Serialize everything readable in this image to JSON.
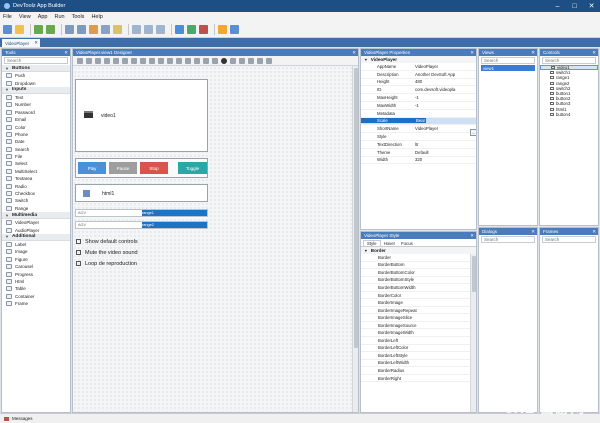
{
  "app": {
    "title": "DevToolz App Builder"
  },
  "menu": [
    "File",
    "View",
    "App",
    "Run",
    "Tools",
    "Help"
  ],
  "doc_tab": {
    "label": "VideoPlayer"
  },
  "tools": {
    "title": "Tools",
    "search_placeholder": "Search",
    "groups": [
      {
        "name": "Buttons",
        "items": [
          "Push",
          "Dropdown"
        ]
      },
      {
        "name": "Inputs",
        "items": [
          "Text",
          "Number",
          "Password",
          "Email",
          "Color",
          "Phone",
          "Date",
          "Search",
          "File",
          "Select",
          "MultiSelect",
          "Textarea",
          "Radio",
          "Checkbox",
          "Switch",
          "Range"
        ]
      },
      {
        "name": "Multimedia",
        "items": [
          "VideoPlayer",
          "AudioPlayer"
        ]
      },
      {
        "name": "Additional",
        "items": [
          "Label",
          "Image",
          "Figure",
          "Carousel",
          "Progress",
          "Html",
          "Table",
          "Container",
          "Frame"
        ]
      }
    ]
  },
  "designer": {
    "tab_label": "VideoPlayer.view1 Designer",
    "video_label": "video1",
    "buttons": [
      "Play",
      "Pause",
      "Stop",
      "Toggle"
    ],
    "button_colors": [
      "#4a90d9",
      "#9e9e9e",
      "#d9534f",
      "#2aa7a7"
    ],
    "text_label": "html1",
    "range_rows": [
      {
        "left": "AGV",
        "mid": "range1",
        "fill": 0.5
      },
      {
        "left": "AGV",
        "mid": "range2",
        "fill": 0.5
      }
    ],
    "checkboxes": [
      "Show default controls",
      "Mute the video sound",
      "Loop de reproduction"
    ]
  },
  "properties": {
    "title": "VideoPlayer Properties",
    "section": "VideoPlayer",
    "rows": [
      {
        "k": "AppName",
        "v": "VideoPlayer"
      },
      {
        "k": "Description",
        "v": "Another DevSoft App"
      },
      {
        "k": "Height",
        "v": "480"
      },
      {
        "k": "ID",
        "v": "com.devsoft.videopla"
      },
      {
        "k": "MaxHeight",
        "v": "-1"
      },
      {
        "k": "MaxWidth",
        "v": "-1"
      },
      {
        "k": "Metadata",
        "v": ""
      },
      {
        "k": "Scale",
        "v": "Bear"
      },
      {
        "k": "ShortName",
        "v": "VideoPlayer"
      },
      {
        "k": "Style",
        "v": ""
      },
      {
        "k": "TextDirection",
        "v": "ltr"
      },
      {
        "k": "Theme",
        "v": "Default"
      },
      {
        "k": "Width",
        "v": "320"
      }
    ],
    "selected_index": 7
  },
  "style_panel": {
    "title": "VideoPlayer Style",
    "tabs": [
      "Style",
      "Hover",
      "Focus"
    ],
    "section": "Border",
    "rows": [
      "Border",
      "BorderBottom",
      "BorderBottomColor",
      "BorderBottomStyle",
      "BorderBottomWidth",
      "BorderColor",
      "BorderImage",
      "BorderImageRepeat",
      "BorderImageSlice",
      "BorderImageSource",
      "BorderImageWidth",
      "BorderLeft",
      "BorderLeftColor",
      "BorderLeftStyle",
      "BorderLeftWidth",
      "BorderRadius",
      "BorderRight"
    ]
  },
  "views": {
    "title": "Views",
    "items": [
      "view1"
    ],
    "search_placeholder": "Search"
  },
  "controls": {
    "title": "Controls",
    "items": [
      "video1",
      "switch1",
      "range1",
      "range2",
      "switch2",
      "button1",
      "button2",
      "button3",
      "html1",
      "button4"
    ],
    "search_placeholder": "Search"
  },
  "dialogs": {
    "title": "Dialogs",
    "search_placeholder": "Search"
  },
  "frames": {
    "title": "Frames",
    "search_placeholder": "Search"
  },
  "status": {
    "label": "Messages"
  },
  "watermark": "3HE 当游网"
}
